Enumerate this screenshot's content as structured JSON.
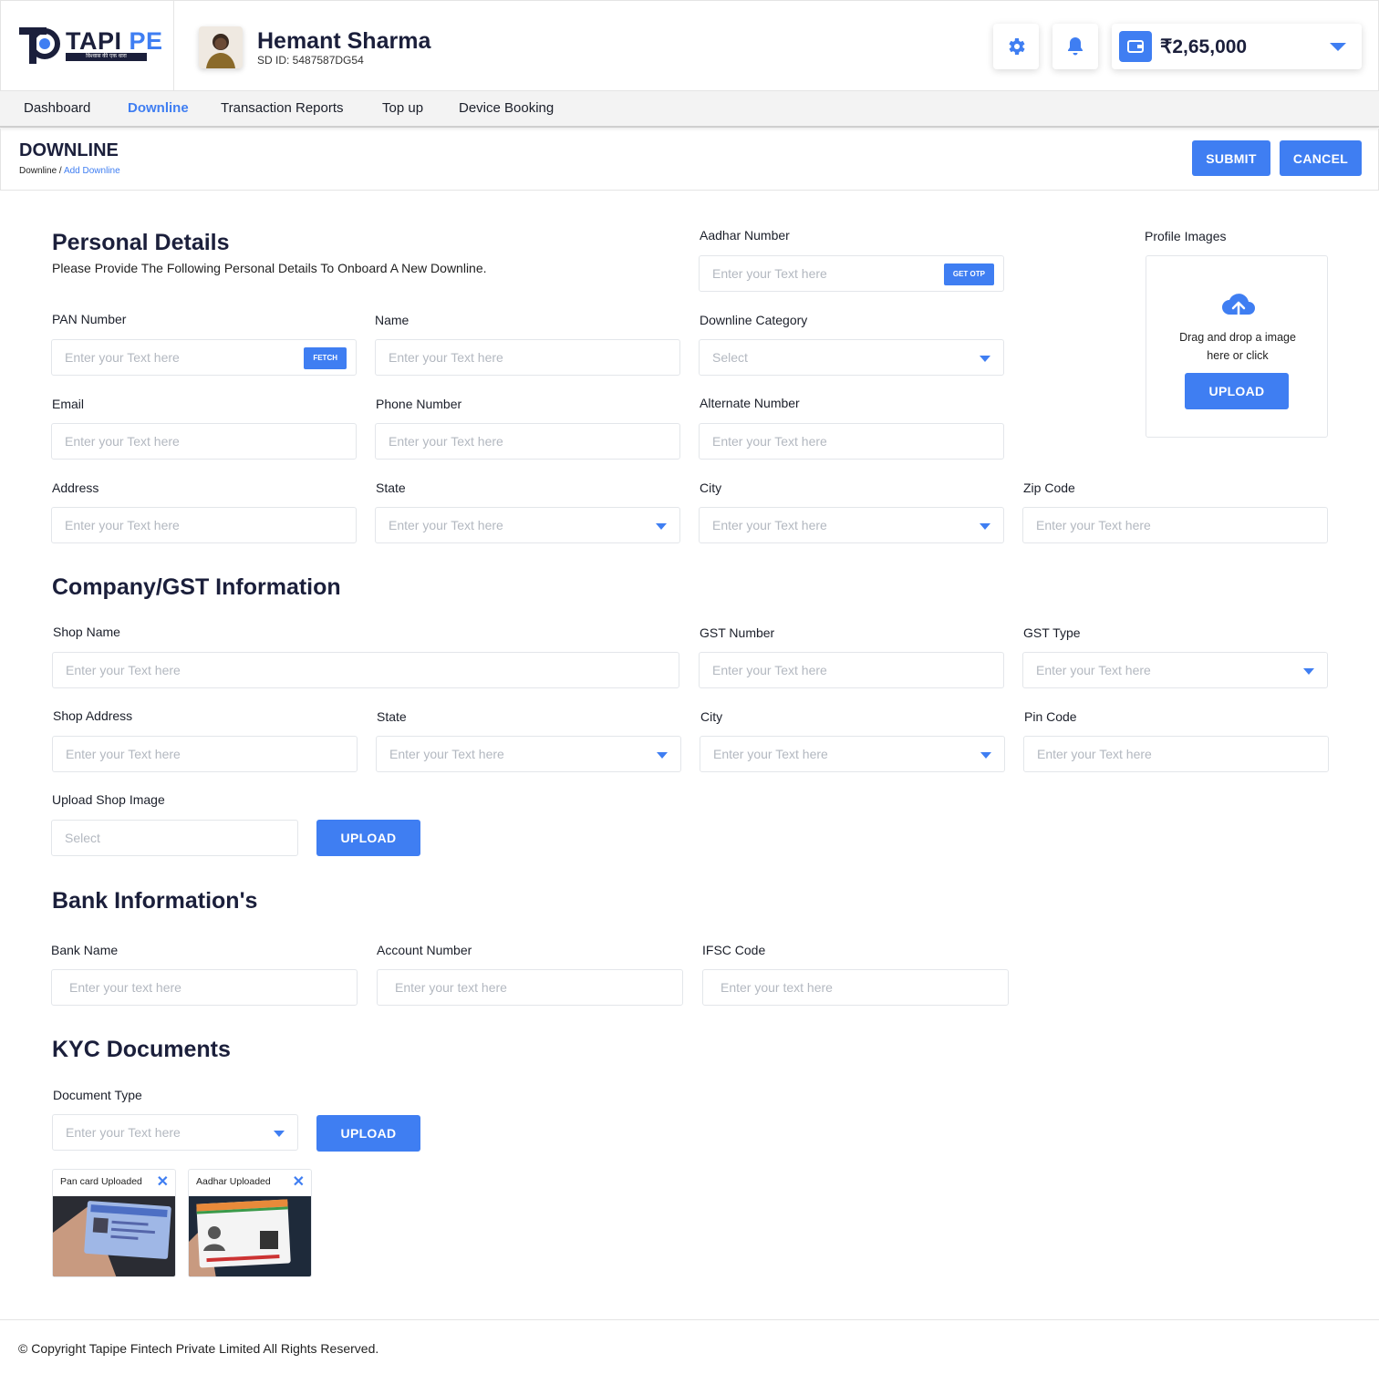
{
  "brand": {
    "name": "TAPIPE",
    "tagline": "विश्वास की एक धारा"
  },
  "user": {
    "name": "Hemant Sharma",
    "sd_id": "SD ID: 5487587DG54"
  },
  "wallet": {
    "amount": "₹2,65,000"
  },
  "nav": {
    "items": [
      {
        "label": "Dashboard"
      },
      {
        "label": "Downline"
      },
      {
        "label": "Transaction Reports"
      },
      {
        "label": "Top up"
      },
      {
        "label": "Device Booking"
      }
    ],
    "active": "Downline"
  },
  "page": {
    "title": "DOWNLINE",
    "breadcrumb_root": "Downline",
    "breadcrumb_sep": "/",
    "breadcrumb_current": "Add Downline",
    "submit_label": "SUBMIT",
    "cancel_label": "CANCEL"
  },
  "personal": {
    "title": "Personal Details",
    "subtitle": "Please Provide The Following Personal Details To Onboard A New Downline.",
    "aadhar_label": "Aadhar Number",
    "aadhar_ph": "Enter your Text here",
    "get_otp": "GET OTP",
    "profile_label": "Profile Images",
    "drop_line1": "Drag and drop a image",
    "drop_line2": "here or click",
    "upload_label": "UPLOAD",
    "pan_label": "PAN Number",
    "pan_ph": "Enter your Text here",
    "fetch": "FETCH",
    "name_label": "Name",
    "name_ph": "Enter your Text here",
    "category_label": "Downline Category",
    "category_value": "Select",
    "email_label": "Email",
    "email_ph": "Enter your Text here",
    "phone_label": "Phone Number",
    "phone_ph": "Enter your Text here",
    "alt_label": "Alternate Number",
    "alt_ph": "Enter your Text here",
    "address_label": "Address",
    "address_ph": "Enter your Text here",
    "state_label": "State",
    "state_ph": "Enter your Text here",
    "city_label": "City",
    "city_ph": "Enter your Text here",
    "zip_label": "Zip Code",
    "zip_ph": "Enter your Text here"
  },
  "company": {
    "title": "Company/GST Information",
    "shop_name_label": "Shop Name",
    "shop_name_ph": "Enter your Text here",
    "gst_number_label": "GST Number",
    "gst_number_ph": "Enter your Text here",
    "gst_type_label": "GST Type",
    "gst_type_ph": "Enter your Text here",
    "shop_address_label": "Shop Address",
    "shop_address_ph": "Enter your Text here",
    "state_label": "State",
    "state_ph": "Enter your Text here",
    "city_label": "City",
    "city_ph": "Enter your Text here",
    "pin_label": "Pin Code",
    "pin_ph": "Enter your Text here",
    "upload_shop_label": "Upload Shop Image",
    "upload_shop_value": "Select",
    "upload_label": "UPLOAD"
  },
  "bank": {
    "title": "Bank Information's",
    "bank_name_label": "Bank Name",
    "bank_name_ph": "Enter your text here",
    "account_label": "Account Number",
    "account_ph": "Enter your text here",
    "ifsc_label": "IFSC Code",
    "ifsc_ph": "Enter your text here"
  },
  "kyc": {
    "title": "KYC Documents",
    "doc_type_label": "Document Type",
    "doc_type_ph": "Enter your Text here",
    "upload_label": "UPLOAD",
    "docs": [
      {
        "label": "Pan card Uploaded"
      },
      {
        "label": "Aadhar Uploaded"
      }
    ]
  },
  "footer": {
    "copyright": "© Copyright Tapipe Fintech Private Limited All Rights Reserved."
  },
  "colors": {
    "accent": "#3f7ef2",
    "heading": "#1b1f3b"
  }
}
